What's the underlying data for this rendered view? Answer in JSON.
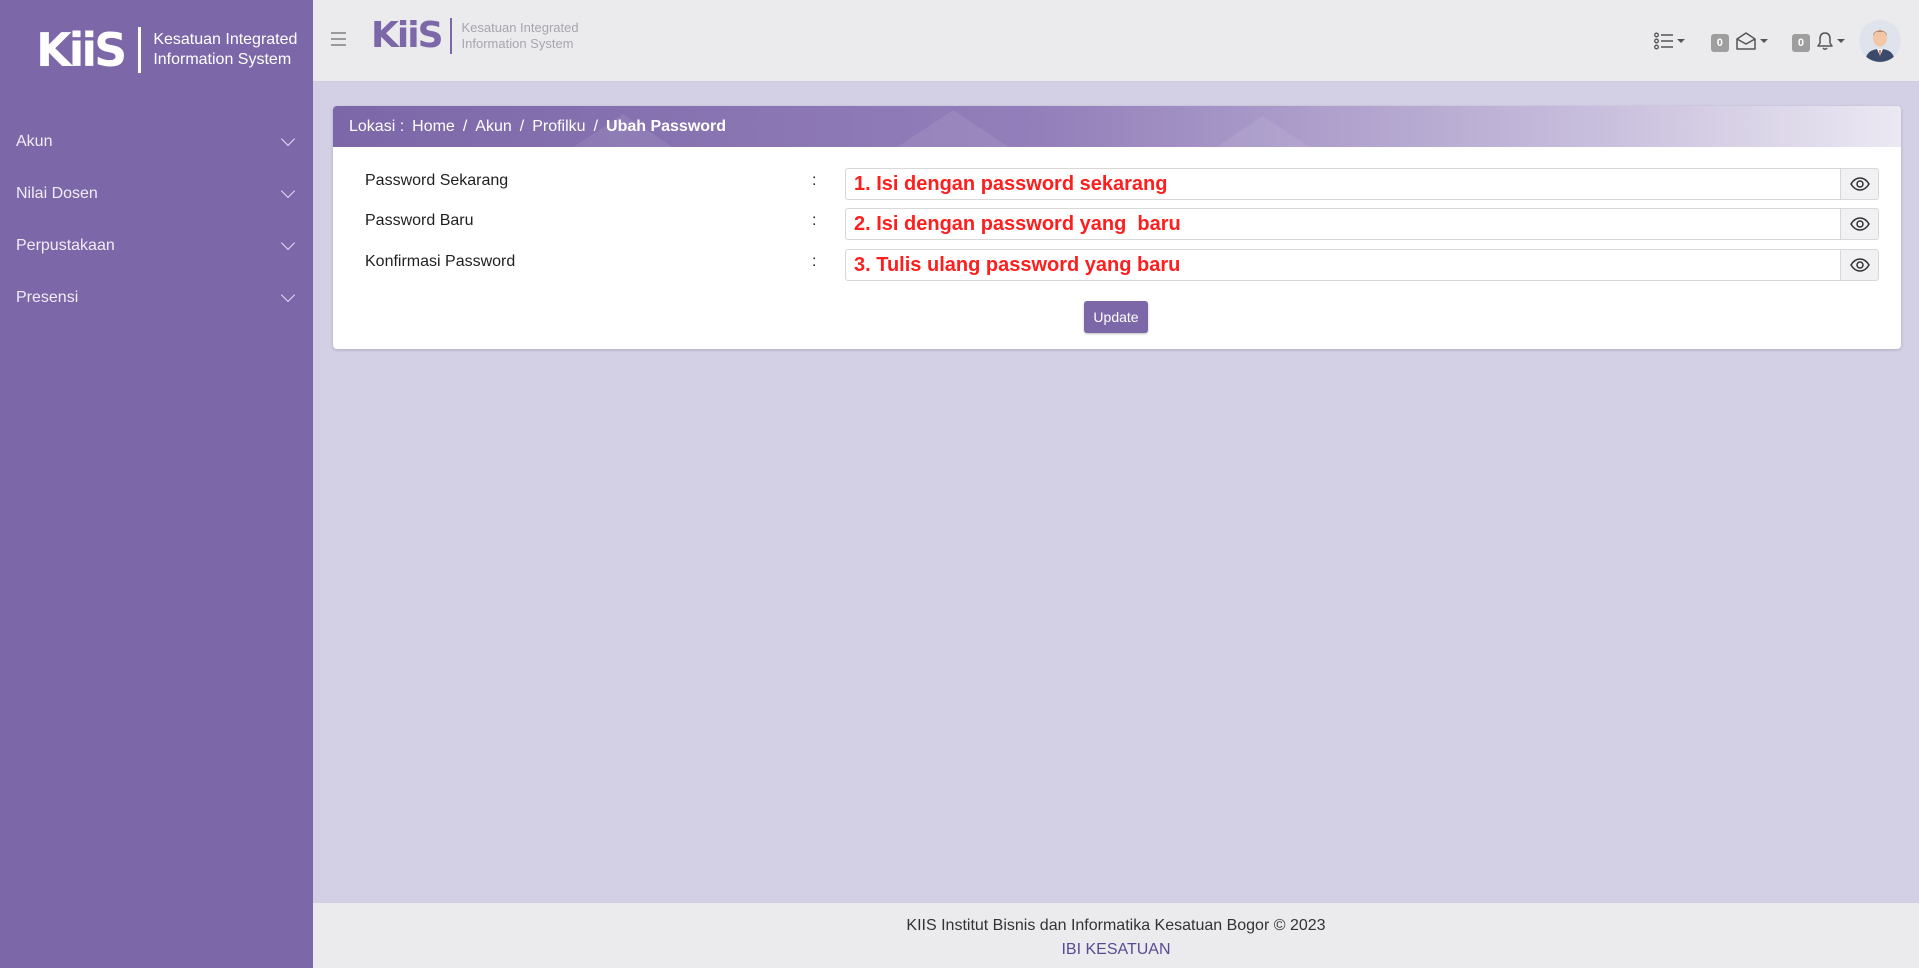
{
  "sidebar": {
    "logo": "KiiS",
    "brand_line1": "Kesatuan Integrated",
    "brand_line2": "Information System",
    "items": [
      {
        "label": "Akun"
      },
      {
        "label": "Nilai Dosen"
      },
      {
        "label": "Perpustakaan"
      },
      {
        "label": "Presensi"
      }
    ]
  },
  "topbar": {
    "logo": "KiiS",
    "brand_line1": "Kesatuan Integrated",
    "brand_line2": "Information System",
    "messages_count": "0",
    "notifications_count": "0"
  },
  "breadcrumb": {
    "prefix": "Lokasi :",
    "items": [
      "Home",
      "Akun",
      "Profilku"
    ],
    "current": "Ubah Password"
  },
  "form": {
    "fields": [
      {
        "label": "Password Sekarang",
        "value": "1. Isi dengan password sekarang"
      },
      {
        "label": "Password Baru",
        "value": "2. Isi dengan password yang  baru"
      },
      {
        "label": "Konfirmasi Password",
        "value": "3. Tulis ulang password yang baru"
      }
    ],
    "colon": ":",
    "submit_label": "Update"
  },
  "footer": {
    "line1": "KIIS Institut Bisnis dan Informatika Kesatuan Bogor © 2023",
    "line2": "IBI KESATUAN"
  },
  "colors": {
    "primary": "#7c67a8",
    "content_bg": "#d3d0e6",
    "annotation_text": "#ff1e1e"
  }
}
